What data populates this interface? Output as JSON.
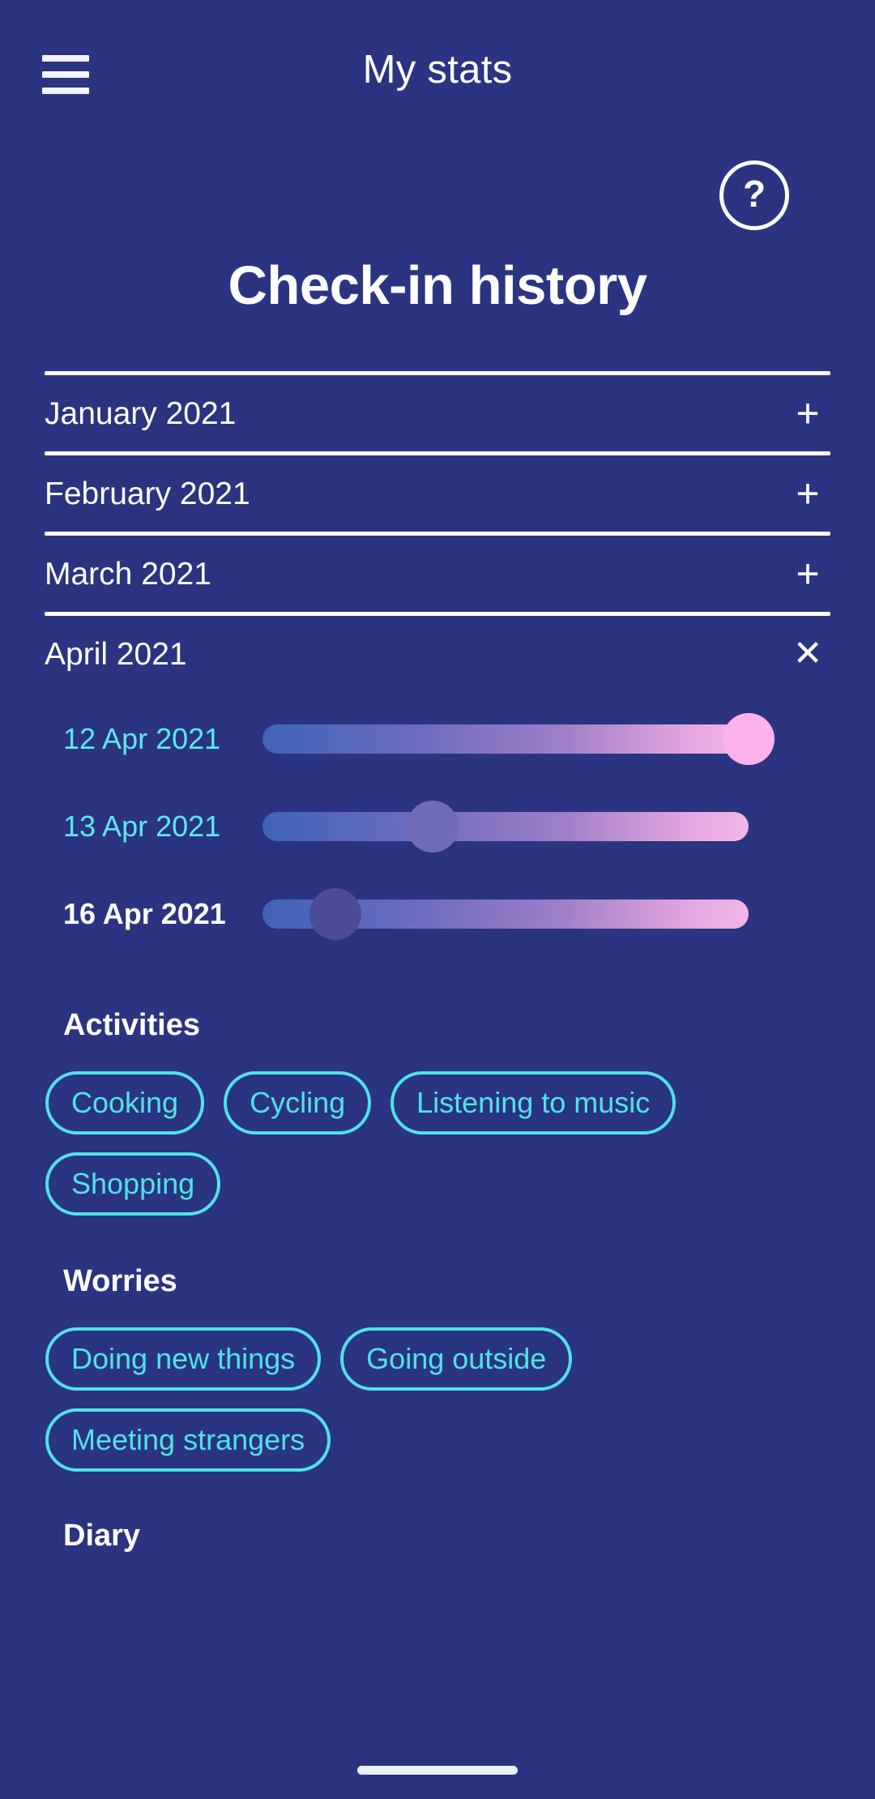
{
  "appbar": {
    "menu_icon": "hamburger-menu-icon",
    "title": "My stats"
  },
  "help": {
    "icon": "question-mark-icon",
    "label": "?"
  },
  "page": {
    "title": "Check-in history"
  },
  "accordion": {
    "months": [
      {
        "label": "January 2021",
        "expanded": false,
        "toggle": "+"
      },
      {
        "label": "February 2021",
        "expanded": false,
        "toggle": "+"
      },
      {
        "label": "March 2021",
        "expanded": false,
        "toggle": "+"
      },
      {
        "label": "April 2021",
        "expanded": true,
        "toggle": "✕"
      }
    ]
  },
  "checkins": [
    {
      "date": "12 Apr 2021",
      "value": 100,
      "current": false
    },
    {
      "date": "13 Apr 2021",
      "value": 35,
      "current": false
    },
    {
      "date": "16 Apr 2021",
      "value": 15,
      "current": true
    }
  ],
  "activities": {
    "heading": "Activities",
    "items": [
      "Cooking",
      "Cycling",
      "Listening to music",
      "Shopping"
    ]
  },
  "worries": {
    "heading": "Worries",
    "items": [
      "Doing new things",
      "Going outside",
      "Meeting strangers"
    ]
  },
  "diary": {
    "heading": "Diary"
  },
  "colors": {
    "background": "#2b3480",
    "accent_cyan": "#4fe3e8",
    "date_cyan": "#5be8f0",
    "slider_start": "#4063b6",
    "slider_end": "#f3b6e6",
    "thumb_full": "#fdb2ec",
    "thumb_mid": "#6f6bb6",
    "thumb_low": "#4b4b96",
    "text_white": "#ffffff"
  }
}
